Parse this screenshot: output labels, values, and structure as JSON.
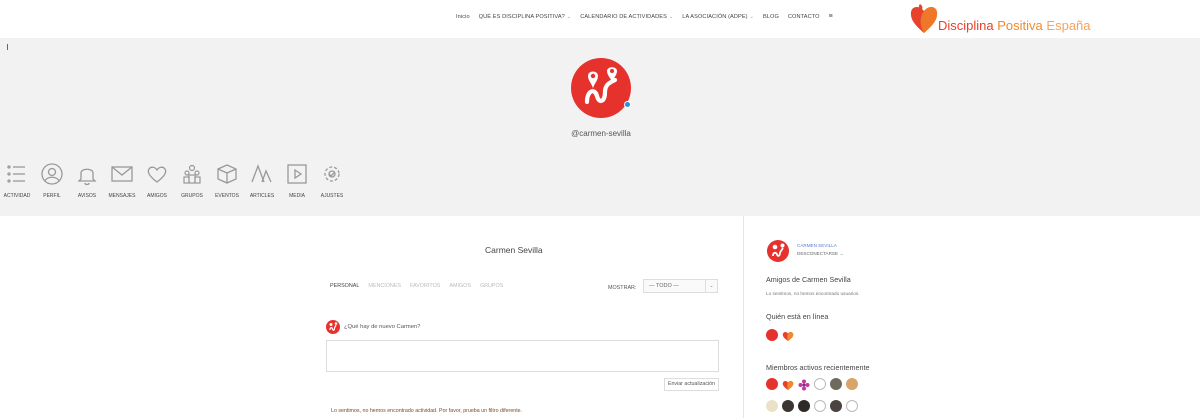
{
  "nav": {
    "items": [
      {
        "label": "Inicio",
        "has_menu": false
      },
      {
        "label": "QUÉ ES DISCIPLINA POSITIVA?",
        "has_menu": true
      },
      {
        "label": "CALENDARIO DE ACTIVIDADES",
        "has_menu": true
      },
      {
        "label": "LA ASOCIACIÓN (ADPE)",
        "has_menu": true
      },
      {
        "label": "BLOG",
        "has_menu": false
      },
      {
        "label": "CONTACTO",
        "has_menu": false
      }
    ],
    "menu_icon": "hamburger-icon",
    "chevron_glyph": "⌄",
    "burger_glyph": "≡"
  },
  "logo": {
    "word1": "Disciplina",
    "word2": "Positiva",
    "word3": "España",
    "colors": {
      "red": "#e8412c",
      "orange": "#f08a2a",
      "light": "#f4a45b"
    }
  },
  "profile": {
    "handle": "@carmen-sevilla",
    "name": "Carmen Sevilla",
    "online": true
  },
  "profile_nav": [
    {
      "label": "ACTIVIDAD",
      "icon": "list-icon",
      "active": true
    },
    {
      "label": "PERFIL",
      "icon": "user-icon"
    },
    {
      "label": "AVISOS",
      "icon": "bell-icon"
    },
    {
      "label": "MENSAJES",
      "icon": "envelope-icon"
    },
    {
      "label": "AMIGOS",
      "icon": "heart-icon"
    },
    {
      "label": "GRUPOS",
      "icon": "group-icon"
    },
    {
      "label": "EVENTOS",
      "icon": "box-icon"
    },
    {
      "label": "ARTICLES",
      "icon": "articles-icon"
    },
    {
      "label": "MEDIA",
      "icon": "media-icon"
    },
    {
      "label": "AJUSTES",
      "icon": "gear-icon"
    }
  ],
  "activity": {
    "tabs": [
      "PERSONAL",
      "MENCIONES",
      "FAVORITOS",
      "AMIGOS",
      "GRUPOS"
    ],
    "active_tab": "PERSONAL",
    "filter_label": "MOSTRAR:",
    "filter_value": "— TODO —",
    "filter_caret": "⌄",
    "post_prompt": "¿Qué hay de nuevo Carmen?",
    "post_button": "Enviar actualización",
    "empty_notice": "Lo sentimos, no hemos encontrado actividad. Por favor, prueba un filtro diferente."
  },
  "sidebar": {
    "user_name": "CARMEN SEVILLA",
    "logout": "DESCONECTARSE →",
    "friends_title": "Amigos de Carmen Sevilla",
    "friends_empty": "Lo sentimos, no hemos encontrado usuarios.",
    "online_title": "Quién está en línea",
    "active_title": "Miembros activos recientemente",
    "online_members": [
      "dp-logo",
      "heart-logo"
    ],
    "active_members_row1": [
      "dp-logo",
      "heart-logo",
      "flower-avatar",
      "default-avatar",
      "photo-avatar",
      "photo-avatar"
    ],
    "active_members_row2": [
      "text-avatar",
      "photo-avatar",
      "photo-avatar",
      "default-avatar",
      "photo-avatar",
      "default-avatar"
    ]
  },
  "colors": {
    "brand_red": "#e5322d",
    "online_dot": "#2a8fd9",
    "link_blue": "#5a79c8",
    "cover_bg": "#f2f2f2"
  }
}
